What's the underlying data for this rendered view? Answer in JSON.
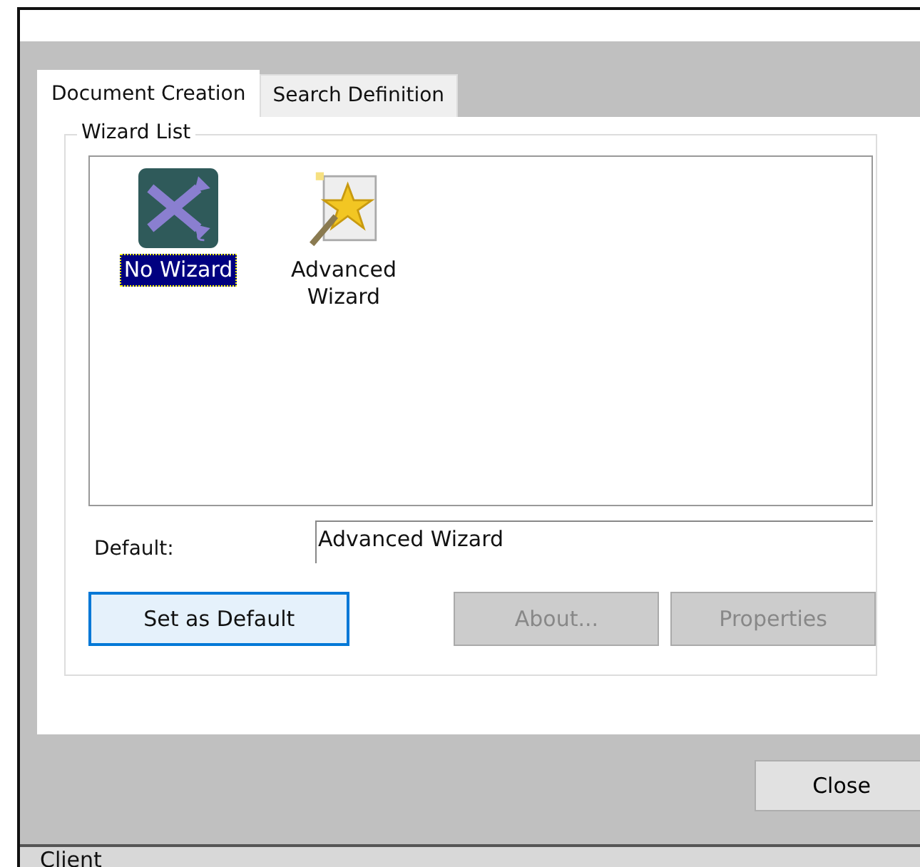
{
  "tabs": [
    {
      "label": "Document Creation",
      "selected": true
    },
    {
      "label": "Search Definition",
      "selected": false
    }
  ],
  "wizard_list": {
    "title": "Wizard List",
    "items": [
      {
        "label": "No Wizard",
        "kind": "none",
        "selected": true
      },
      {
        "label": "Advanced\nWizard",
        "kind": "advanced",
        "selected": false
      }
    ]
  },
  "default": {
    "label": "Default:",
    "value": "Advanced Wizard"
  },
  "buttons": [
    {
      "label": "Set as Default",
      "disabled": false
    },
    {
      "label": "About...",
      "disabled": true
    },
    {
      "label": "Properties",
      "disabled": true
    }
  ],
  "close_button": "Close",
  "status_bar": "Client"
}
